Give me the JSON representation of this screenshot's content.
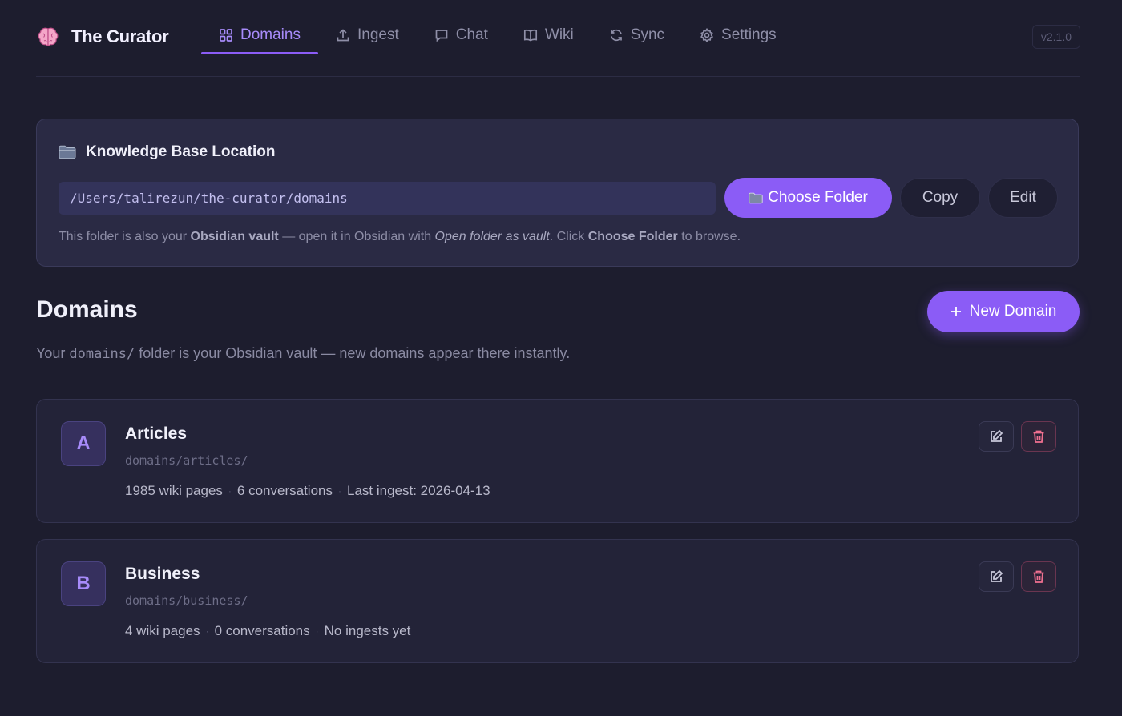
{
  "app": {
    "title": "The Curator",
    "version": "v2.1.0"
  },
  "nav": [
    {
      "label": "Domains",
      "icon": "grid-icon",
      "active": true
    },
    {
      "label": "Ingest",
      "icon": "upload-icon",
      "active": false
    },
    {
      "label": "Chat",
      "icon": "chat-icon",
      "active": false
    },
    {
      "label": "Wiki",
      "icon": "book-icon",
      "active": false
    },
    {
      "label": "Sync",
      "icon": "sync-icon",
      "active": false
    },
    {
      "label": "Settings",
      "icon": "gear-icon",
      "active": false
    }
  ],
  "kb": {
    "title": "Knowledge Base Location",
    "path": "/Users/talirezun/the-curator/domains",
    "choose_label": "Choose Folder",
    "copy_label": "Copy",
    "edit_label": "Edit",
    "hint": {
      "t1": "This folder is also your ",
      "b1": "Obsidian vault",
      "t2": " — open it in Obsidian with ",
      "i1": "Open folder as vault",
      "t3": ". Click ",
      "b2": "Choose Folder",
      "t4": " to browse."
    }
  },
  "domains": {
    "title": "Domains",
    "new_label": "New Domain",
    "sub_pre": "Your ",
    "sub_mono": "domains/",
    "sub_post": " folder is your Obsidian vault — new domains appear there instantly.",
    "items": [
      {
        "initial": "A",
        "name": "Articles",
        "path": "domains/articles/",
        "pages": "1985 wiki pages",
        "conversations": "6 conversations",
        "ingest": "Last ingest: 2026-04-13"
      },
      {
        "initial": "B",
        "name": "Business",
        "path": "domains/business/",
        "pages": "4 wiki pages",
        "conversations": "0 conversations",
        "ingest": "No ingests yet"
      }
    ]
  },
  "colors": {
    "accent": "#8b5cf6",
    "background": "#1d1d2e",
    "danger": "#f07090"
  }
}
